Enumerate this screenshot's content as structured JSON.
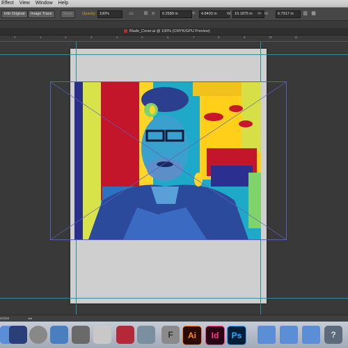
{
  "menubar": {
    "items": [
      "Effect",
      "View",
      "Window",
      "Help"
    ]
  },
  "control_bar": {
    "embed_button": "Info Original",
    "image_trace_button": "Image Trace",
    "mask_button": "Mask",
    "opacity_label": "Opacity:",
    "opacity_value": "100%",
    "x_value": "0.2589 in",
    "y_value": "4.8403 in",
    "w_value": "10.1875 in",
    "h_value": "6.7917 in"
  },
  "document_tab": {
    "title": "Blade_Cover.ai @ 100% (CMYK/GPU Preview)"
  },
  "ruler": {
    "ticks": [
      "0",
      "1",
      "2",
      "3",
      "4",
      "5",
      "6",
      "7",
      "8",
      "9",
      "10",
      "11"
    ]
  },
  "statusbar": {
    "left_text": "ection"
  },
  "dock": {
    "apps": [
      "Finder",
      "Safari",
      "Photos",
      "Preview",
      "Launchpad",
      "Screen Sharing",
      "Photo Booth",
      "FontBook",
      "System",
      "Illustrator",
      "InDesign",
      "Photoshop",
      "Folder",
      "Folder",
      "Folder",
      "Help"
    ],
    "ai_label": "Ai",
    "id_label": "Id",
    "ps_label": "Ps"
  },
  "colors": {
    "guide": "#2f8f93",
    "artboard": "#cfcfcf",
    "bbox": "#5a62b8"
  }
}
